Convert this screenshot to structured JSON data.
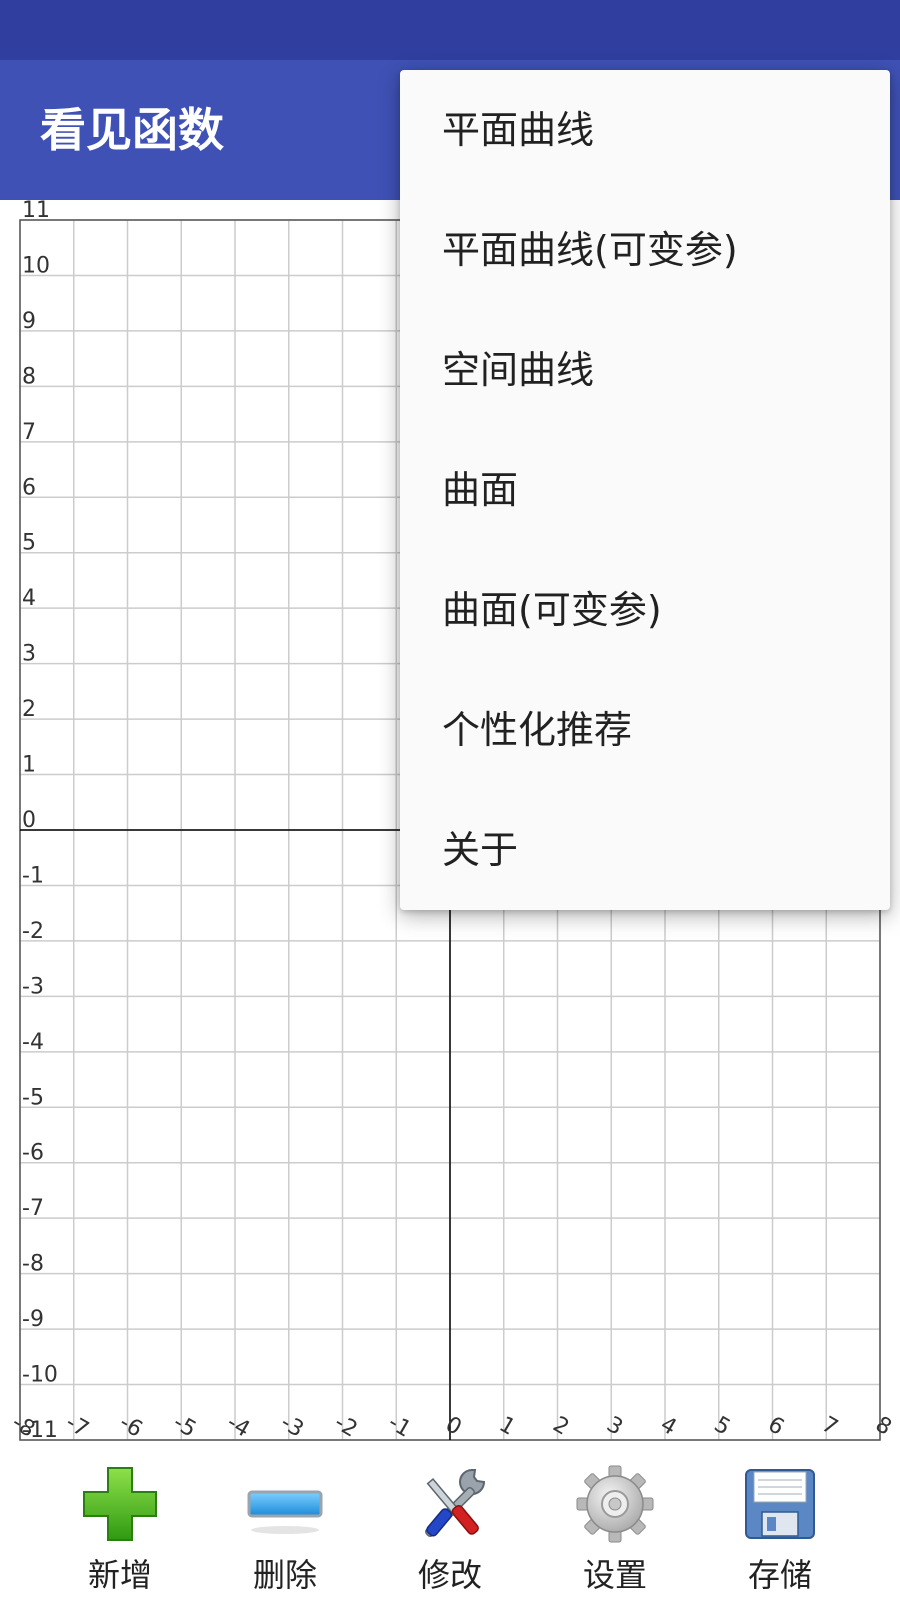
{
  "app": {
    "title": "看见函数"
  },
  "graph": {
    "x_range": [
      -8,
      8
    ],
    "y_range": [
      -11,
      11
    ],
    "x_tick_labels": [
      "-8",
      "-7",
      "-6",
      "-5",
      "-4",
      "-3",
      "-2",
      "-1",
      "0",
      "1",
      "2",
      "3",
      "4",
      "5",
      "6",
      "7",
      "8"
    ],
    "y_tick_labels": [
      "11",
      "10",
      "9",
      "8",
      "7",
      "6",
      "5",
      "4",
      "3",
      "2",
      "1",
      "0",
      "-1",
      "-2",
      "-3",
      "-4",
      "-5",
      "-6",
      "-7",
      "-8",
      "-9",
      "-10",
      "-11"
    ],
    "grid": true,
    "colors": {
      "grid": "#cccccc",
      "axis": "#000000",
      "label": "#333333"
    }
  },
  "menu": {
    "items": [
      {
        "label": "平面曲线"
      },
      {
        "label": "平面曲线(可变参)"
      },
      {
        "label": "空间曲线"
      },
      {
        "label": "曲面"
      },
      {
        "label": "曲面(可变参)"
      },
      {
        "label": "个性化推荐"
      },
      {
        "label": "关于"
      }
    ]
  },
  "toolbar": {
    "add": {
      "label": "新增",
      "icon": "plus-icon"
    },
    "delete": {
      "label": "删除",
      "icon": "minus-icon"
    },
    "edit": {
      "label": "修改",
      "icon": "tools-icon"
    },
    "settings": {
      "label": "设置",
      "icon": "gear-icon"
    },
    "save": {
      "label": "存储",
      "icon": "floppy-disk-icon"
    }
  },
  "colors": {
    "status_bar": "#303f9f",
    "app_bar": "#3f51b5",
    "menu_background": "#fafafa"
  }
}
